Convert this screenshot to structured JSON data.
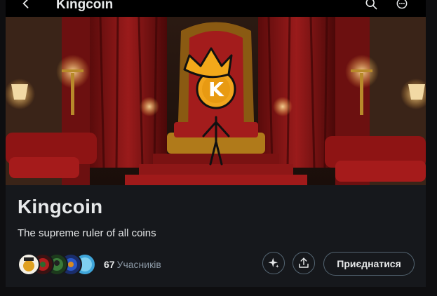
{
  "header": {
    "title": "Kingcoin",
    "back_icon": "arrow-left-icon",
    "search_icon": "search-icon",
    "more_icon": "more-icon"
  },
  "banner": {
    "coin_letter": "K"
  },
  "community": {
    "name": "Kingcoin",
    "description": "The supreme ruler of all coins",
    "member_count": "67",
    "member_label": "Учасників"
  },
  "actions": {
    "join_label": "Приєднатися",
    "grok_icon": "sparkle-icon",
    "share_icon": "share-icon"
  },
  "colors": {
    "background": "#16181c",
    "text": "#e7e9ea",
    "muted": "#8b98a5",
    "border": "#536471",
    "curtain": "#7a1414",
    "gold": "#d9a21e"
  }
}
